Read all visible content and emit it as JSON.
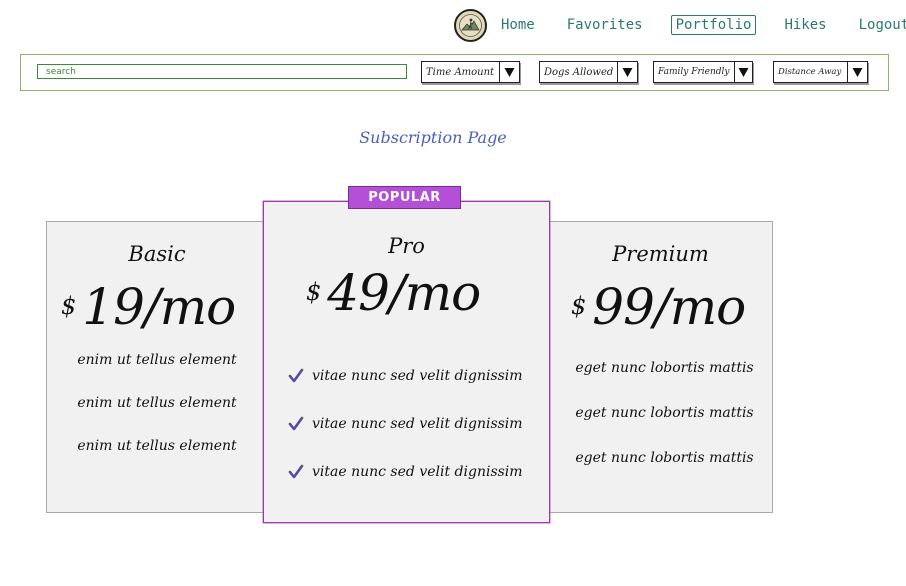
{
  "nav": {
    "items": [
      {
        "label": "Home",
        "active": false
      },
      {
        "label": "Favorites",
        "active": false
      },
      {
        "label": "Portfolio",
        "active": true
      },
      {
        "label": "Hikes",
        "active": false
      },
      {
        "label": "Logout",
        "active": false
      }
    ],
    "logo_icon": "hiker-logo-icon"
  },
  "filters": {
    "search_placeholder": "search",
    "dropdowns": [
      {
        "label": "Time Amount"
      },
      {
        "label": "Dogs Allowed"
      },
      {
        "label": "Family Friendly"
      },
      {
        "label": "Distance Away"
      }
    ],
    "arrow_icon": "triangle-down-icon"
  },
  "page": {
    "title": "Subscription Page"
  },
  "plans": {
    "badge": "POPULAR",
    "basic": {
      "name": "Basic",
      "currency": "$",
      "price": "19/mo",
      "features": [
        "enim ut tellus element",
        "enim ut tellus element",
        "enim ut tellus element"
      ]
    },
    "pro": {
      "name": "Pro",
      "currency": "$",
      "price": "49/mo",
      "features": [
        "vitae nunc sed velit dignissim",
        "vitae nunc sed velit dignissim",
        "vitae nunc sed velit dignissim"
      ]
    },
    "premium": {
      "name": "Premium",
      "currency": "$",
      "price": "99/mo",
      "features": [
        "eget nunc lobortis mattis",
        "eget nunc lobortis mattis",
        "eget nunc lobortis mattis"
      ]
    }
  },
  "colors": {
    "nav_link": "#2a7a6e",
    "filter_border": "#8bb66a",
    "title": "#4a5fb8",
    "badge": "#b44fd8",
    "check": "#5a4a9a"
  }
}
